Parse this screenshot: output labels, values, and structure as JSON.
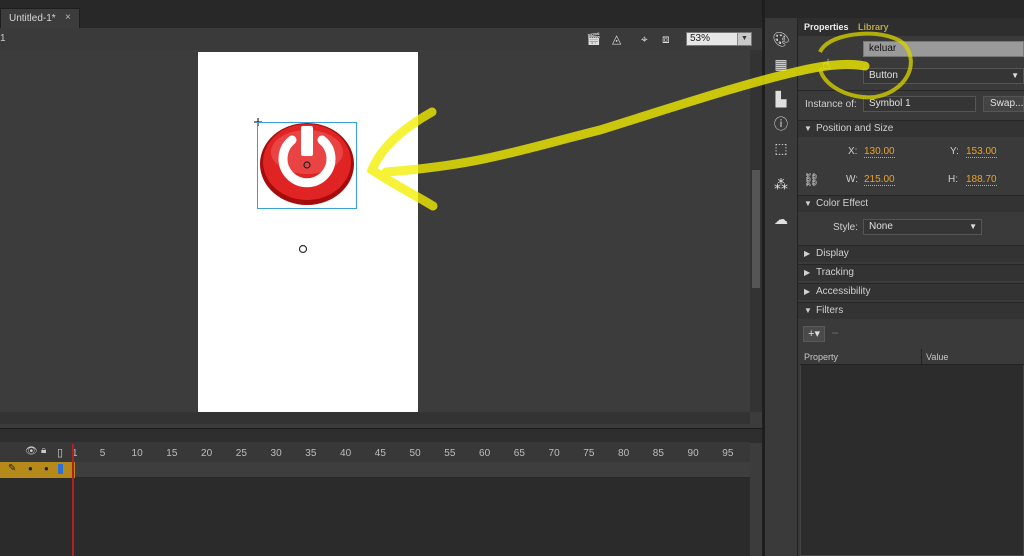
{
  "document": {
    "tab_title": "Untitled-1*",
    "tab_close": "×",
    "scene_number": "1"
  },
  "editbar": {
    "zoom": "53%"
  },
  "timeline": {
    "frame_ticks": [
      "1",
      "5",
      "10",
      "15",
      "20",
      "25",
      "30",
      "35",
      "40",
      "45",
      "50",
      "55",
      "60",
      "65",
      "70",
      "75",
      "80",
      "85",
      "90",
      "95"
    ]
  },
  "panel": {
    "tabs": {
      "properties": "Properties",
      "library": "Library"
    },
    "instance_name": "keluar",
    "symbol_type": "Button",
    "instance_of_label": "Instance of:",
    "instance_of_value": "Symbol 1",
    "swap_label": "Swap...",
    "position_size": {
      "title": "Position and Size",
      "x_label": "X:",
      "x": "130.00",
      "y_label": "Y:",
      "y": "153.00",
      "w_label": "W:",
      "w": "215.00",
      "h_label": "H:",
      "h": "188.70"
    },
    "color_effect": {
      "title": "Color Effect",
      "style_label": "Style:",
      "style": "None"
    },
    "sections": {
      "display": "Display",
      "tracking": "Tracking",
      "accessibility": "Accessibility",
      "filters": "Filters"
    },
    "filters_table": {
      "col_property": "Property",
      "col_value": "Value"
    }
  },
  "colors": {
    "annotation": "#ffff00",
    "accent_value": "#e8a22a",
    "layer_highlight": "#b58a1a",
    "playhead": "#b02020"
  },
  "icons": [
    "clapper-icon",
    "symbol-icon",
    "snap-icon",
    "clip-icon",
    "palette-icon",
    "grid-icon",
    "align-icon",
    "info-icon",
    "transform-icon",
    "components-icon",
    "cc-libraries-icon",
    "button-symbol-icon",
    "link-icon",
    "power-icon"
  ]
}
